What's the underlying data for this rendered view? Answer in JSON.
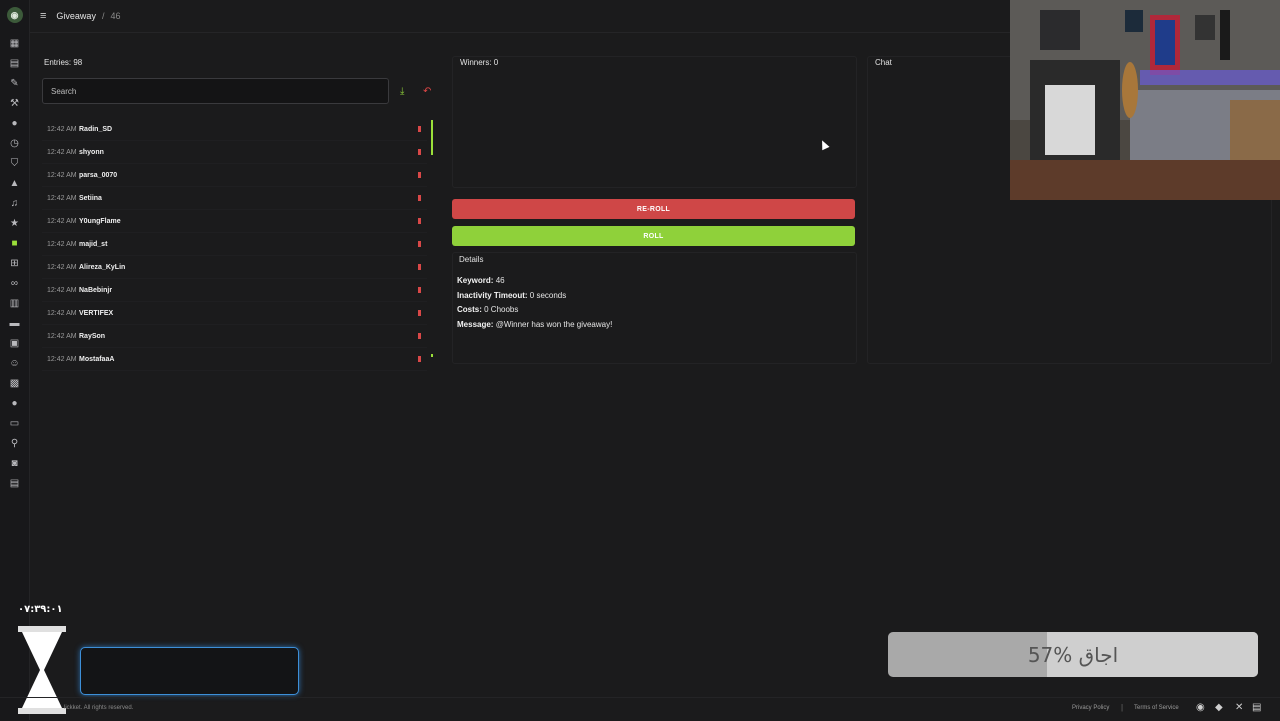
{
  "breadcrumb": {
    "section": "Giveaway",
    "separator": "/",
    "id": "46"
  },
  "entries_panel": {
    "title": "Entries: 98",
    "search_placeholder": "Search",
    "items": [
      {
        "time": "12:42 AM",
        "name": "Radin_SD"
      },
      {
        "time": "12:42 AM",
        "name": "shyonn"
      },
      {
        "time": "12:42 AM",
        "name": "parsa_0070"
      },
      {
        "time": "12:42 AM",
        "name": "Setiina"
      },
      {
        "time": "12:42 AM",
        "name": "Y0ungFlame"
      },
      {
        "time": "12:42 AM",
        "name": "majid_st"
      },
      {
        "time": "12:42 AM",
        "name": "Alireza_KyLin"
      },
      {
        "time": "12:42 AM",
        "name": "NaBebinjr"
      },
      {
        "time": "12:42 AM",
        "name": "VERTIFEX"
      },
      {
        "time": "12:42 AM",
        "name": "RaySon"
      },
      {
        "time": "12:42 AM",
        "name": "MostafaaA"
      }
    ]
  },
  "winners_panel": {
    "title": "Winners: 0"
  },
  "buttons": {
    "reroll": "RE-ROLL",
    "roll": "ROLL"
  },
  "details": {
    "title": "Details",
    "keyword_label": "Keyword:",
    "keyword_value": "46",
    "inactivity_label": "Inactivity Timeout:",
    "inactivity_value": "0 seconds",
    "costs_label": "Costs:",
    "costs_value": "0 Choobs",
    "message_label": "Message:",
    "message_value": "@Winner has won the giveaway!"
  },
  "chat_panel": {
    "title": "Chat"
  },
  "overlay": {
    "timer": "۰۷:۳۹:۰۱",
    "progress_label": "57% اجاق",
    "progress_fraction": 0.57
  },
  "footer": {
    "copyright": "lickket. All rights reserved.",
    "privacy": "Privacy Policy",
    "terms": "Terms of Service"
  },
  "colors": {
    "accent_green": "#8fd13a",
    "danger_red": "#cf4747",
    "background": "#1b1b1c"
  }
}
